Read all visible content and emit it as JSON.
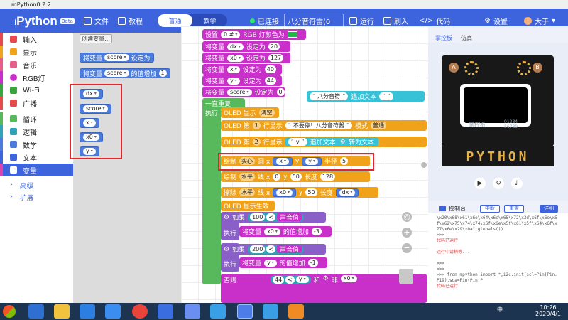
{
  "window": {
    "title": "mPython0.2.2"
  },
  "header": {
    "logo_text": "mPython",
    "logo_badge": "Beta",
    "menu": {
      "file": "文件",
      "tutorial": "教程"
    },
    "mode": {
      "normal": "普通",
      "teach": "教学"
    },
    "connection": "已连接",
    "filename": "八分音符雷(0",
    "actions": {
      "run": "运行",
      "flash": "刷入",
      "code": "代码",
      "settings": "设置",
      "user": "大于"
    }
  },
  "categories": [
    {
      "label": "输入",
      "color": "#e8494f"
    },
    {
      "label": "显示",
      "color": "#f0a31a"
    },
    {
      "label": "音乐",
      "color": "#e65d8a"
    },
    {
      "label": "RGB灯",
      "color": "#c930c9"
    },
    {
      "label": "Wi-Fi",
      "color": "#3aa53e"
    },
    {
      "label": "广播",
      "color": "#e54b4b"
    },
    {
      "label": "循环",
      "color": "#58b85c"
    },
    {
      "label": "逻辑",
      "color": "#2fa4b8"
    },
    {
      "label": "数学",
      "color": "#4c7cdb"
    },
    {
      "label": "文本",
      "color": "#3d63dd"
    },
    {
      "label": "变量",
      "color": "#d946b2"
    }
  ],
  "categories_more": [
    {
      "label": "高级"
    },
    {
      "label": "扩展"
    }
  ],
  "flyout": {
    "create_var": "创建变量...",
    "set_label": "将变量",
    "set_to": "设定为",
    "incr_by": "的值增加",
    "var_score": "score",
    "incr_value": "1",
    "vars": [
      "dx",
      "score",
      "x",
      "x0",
      "y"
    ]
  },
  "workspace": {
    "setup_rgb": {
      "label": "设置",
      "which": "0 #",
      "rest": "RGB 灯颜色为"
    },
    "assigns": [
      {
        "var": "dx",
        "val": "20"
      },
      {
        "var": "x0",
        "val": "127"
      },
      {
        "var": "x",
        "val": "40"
      },
      {
        "var": "y",
        "val": "44"
      },
      {
        "var": "score",
        "val": "0"
      }
    ],
    "assign_label": "将变量",
    "assign_to": "设定为",
    "loop_label": "一直重复",
    "exec_label": "执行",
    "oled_clear": {
      "label": "OLED 显示",
      "opt": "清空"
    },
    "oled_line1": {
      "prefix": "OLED 第",
      "n": "1",
      "mid": "行显示",
      "text": "不要停！八分音符酱",
      "mode": "模式",
      "mode_val": "普通"
    },
    "oled_line2": {
      "prefix": "OLED 第",
      "n": "2",
      "mid": "行显示",
      "text": "v",
      "append": "追加文本",
      "conv": "转为文本"
    },
    "append_block": {
      "text": "八分音符",
      "append": "追加文本"
    },
    "draw_circle": {
      "label": "绘制",
      "fill": "实心",
      "shape": "圆 x",
      "x": "x",
      "yl": "y",
      "y": "y",
      "r_label": "半径",
      "r": "5"
    },
    "draw_hline": {
      "label": "绘制",
      "dir": "水平",
      "line_x": "线 x",
      "x": "0",
      "yl": "y",
      "y": "50",
      "len_label": "长度",
      "len": "128"
    },
    "erase_hline": {
      "label": "擦除",
      "dir": "水平",
      "line_x": "线 x",
      "x": "x0",
      "yl": "y",
      "y": "50",
      "len_label": "长度",
      "len": "dx"
    },
    "oled_apply": "OLED 显示生效",
    "if1": {
      "if": "如果",
      "num": "100",
      "op": "<",
      "sensor": "声音值",
      "exec": "执行",
      "var": "x0",
      "incr": "的值增加",
      "val": "-3"
    },
    "if2": {
      "if": "如果",
      "num": "200",
      "op": "<",
      "sensor": "声音值",
      "exec": "执行",
      "var": "y",
      "incr": "的值增加",
      "val": "-1"
    },
    "else_row": {
      "else": "否则",
      "num": "44",
      "op": "<",
      "var": "y",
      "and": "和",
      "not": "非",
      "var2": "x0"
    }
  },
  "panel": {
    "tab_board": "掌控板",
    "tab_sim": "仿真",
    "board_letters": "PYTHON",
    "board_brand": "掌控板",
    "board_code": "01234 56789",
    "pin_a": "A",
    "pin_b": "B",
    "console_title": "控制台",
    "console_btns": {
      "interrupt": "中断",
      "reset": "重置",
      "detail": "详细"
    },
    "console_lines": [
      "\\x20\\x68\\x61\\x6e\\x64\\x6c\\x65\\x72\\x3d\\x6f\\x6e\\x5f\\x62\\x75\\x74\\x74\\x6f\\x6e\\x5f\\x61\\x5f\\x64\\x6f\\x77\\x6e\\x29\\x0a\",globals())",
      ">>>",
      "代码已运行",
      "",
      "运行中请稍等...",
      "",
      ">>>",
      ">>>",
      ">>> from mpython import *;i2c.init(scl=Pin(Pin.P19),sda=Pin(Pin.P",
      "代码已运行"
    ]
  },
  "taskbar": {
    "time": "10:26",
    "date": "2020/4/1",
    "lang": "中"
  }
}
